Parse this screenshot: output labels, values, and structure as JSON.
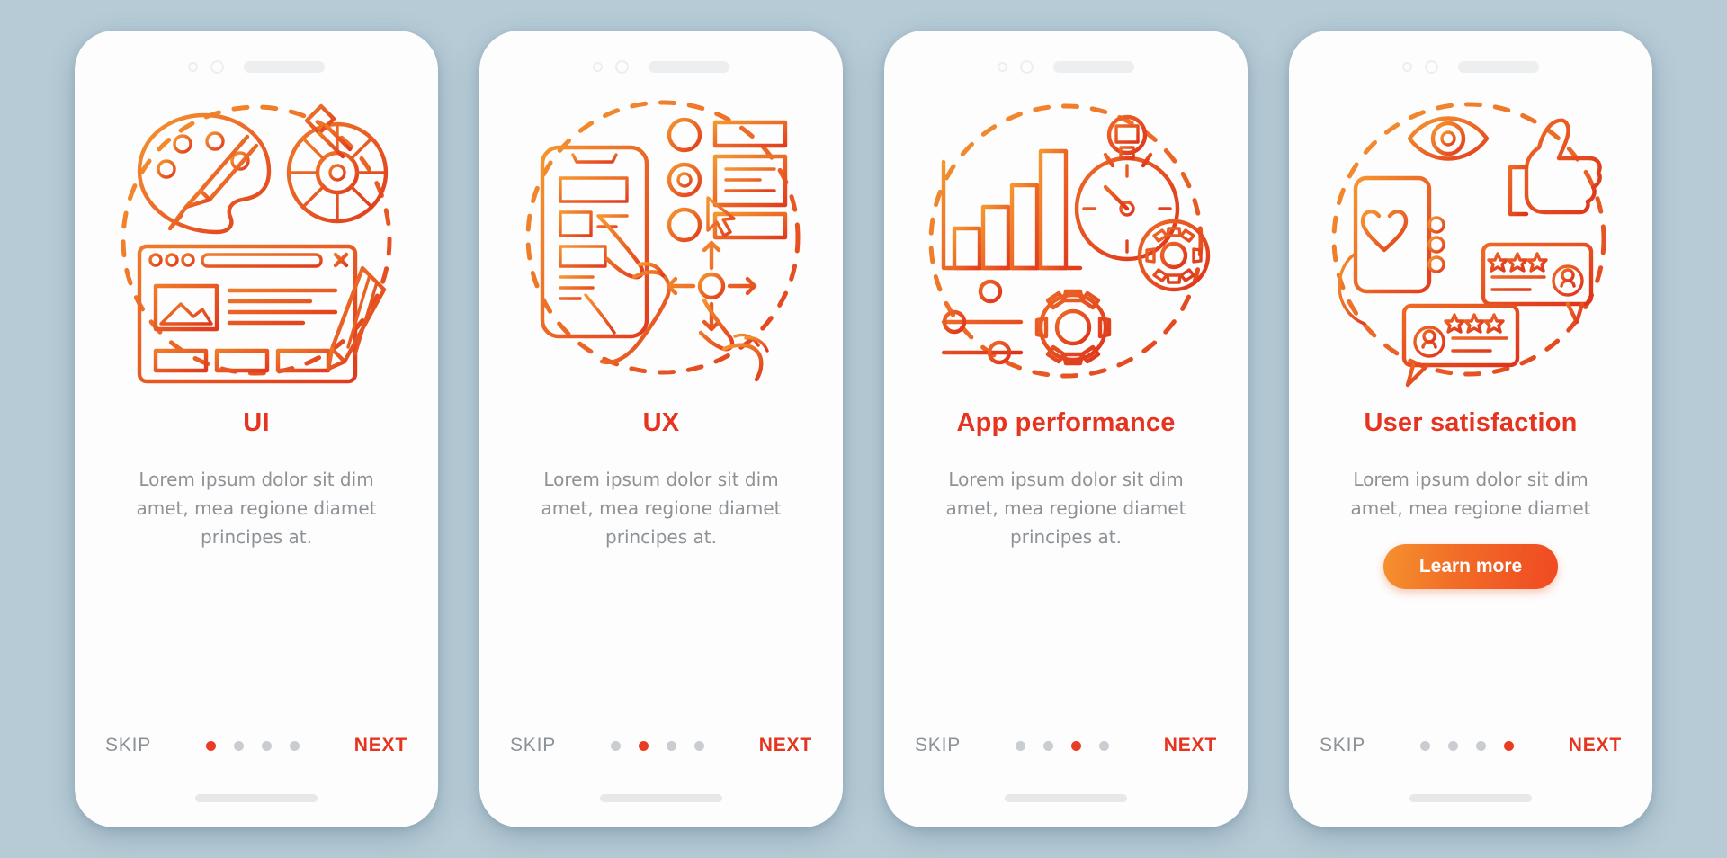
{
  "background_color": "#b6cbd6",
  "theme": {
    "accent_red": "#e5341f",
    "accent_orange": "#f4912e",
    "muted_text": "#8d9297",
    "dot_inactive": "#c9cdd1",
    "card_bg": "#fdfdfd"
  },
  "shared": {
    "skip_label": "SKIP",
    "next_label": "NEXT",
    "dot_count": 4
  },
  "screens": [
    {
      "id": "ui",
      "title": "UI",
      "body": "Lorem ipsum dolor sit dim amet, mea regione diamet principes at.",
      "active_dot": 0,
      "has_cta": false,
      "cta_label": "",
      "illustration": "palette-colorwheel-browser-pencil"
    },
    {
      "id": "ux",
      "title": "UX",
      "body": "Lorem ipsum dolor sit dim amet, mea regione diamet principes at.",
      "active_dot": 1,
      "has_cta": false,
      "cta_label": "",
      "illustration": "phone-hand-radio-wireframe-gestures"
    },
    {
      "id": "app-performance",
      "title": "App performance",
      "body": "Lorem ipsum dolor sit dim amet, mea regione diamet principes at.",
      "active_dot": 2,
      "has_cta": false,
      "cta_label": "",
      "illustration": "barchart-stopwatch-gears-sliders"
    },
    {
      "id": "user-satisfaction",
      "title": "User satisfaction",
      "body": "Lorem ipsum dolor sit dim amet, mea regione diamet",
      "active_dot": 3,
      "has_cta": true,
      "cta_label": "Learn more",
      "illustration": "eye-thumbsup-phone-heart-reviews"
    }
  ]
}
